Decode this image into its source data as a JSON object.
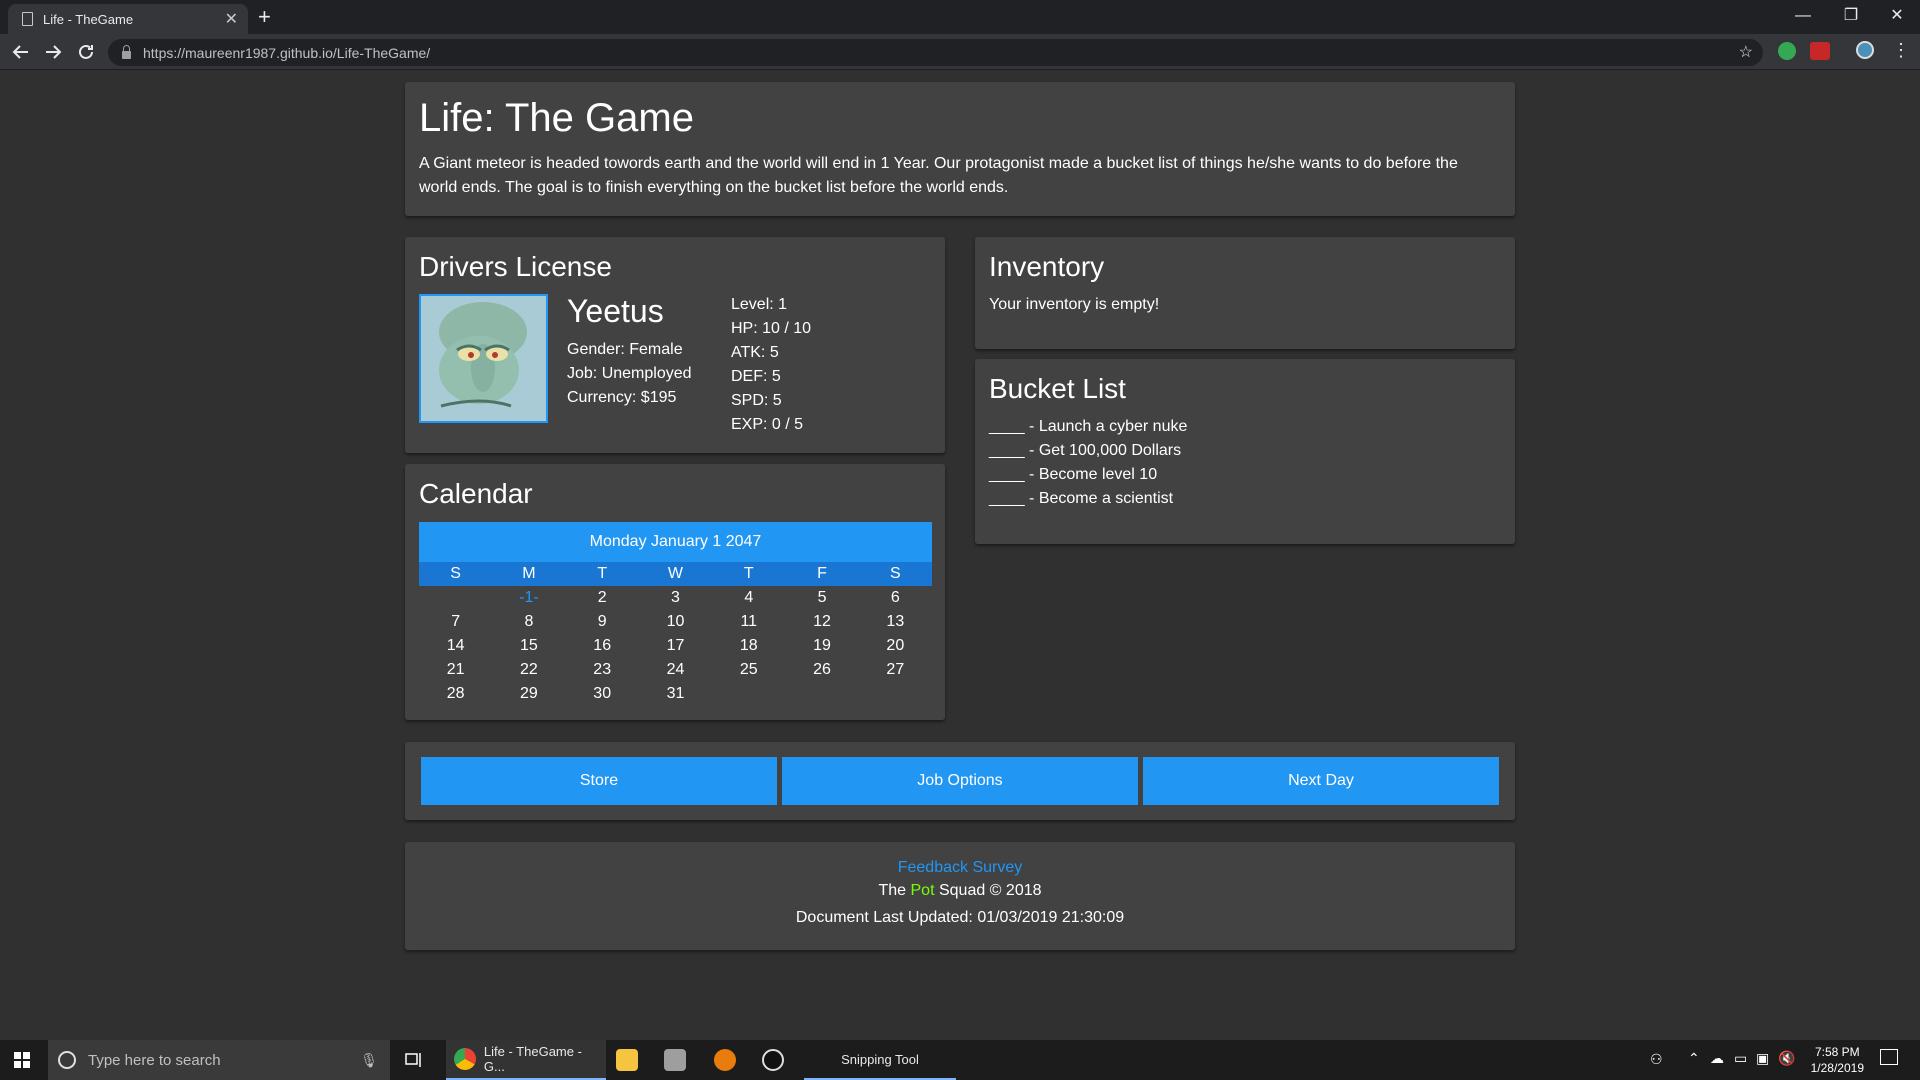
{
  "browser": {
    "tab_title": "Life - TheGame",
    "tab_close": "✕",
    "new_tab": "+",
    "url": "https://maureenr1987.github.io/Life-TheGame/",
    "minimize": "—",
    "restore": "❐",
    "close": "✕",
    "icons": [
      "back-arrow-icon",
      "forward-arrow-icon",
      "reload-icon",
      "lock-icon",
      "star-icon"
    ]
  },
  "header": {
    "title": "Life: The Game",
    "description": "A Giant meteor is headed towords earth and the world will end in 1 Year. Our protagonist made a bucket list of things he/she wants to do before the world ends. The goal is to finish everything on the bucket list before the world ends."
  },
  "license": {
    "heading": "Drivers License",
    "name": "Yeetus",
    "gender": "Gender: Female",
    "job": "Job: Unemployed",
    "currency": "Currency: $195",
    "stats": [
      "Level: 1",
      "HP: 10 / 10",
      "ATK: 5",
      "DEF: 5",
      "SPD: 5",
      "EXP: 0 / 5"
    ]
  },
  "inventory": {
    "heading": "Inventory",
    "empty_text": "Your inventory is empty!"
  },
  "bucket_list": {
    "heading": "Bucket List",
    "items": [
      "____ - Launch a cyber nuke",
      "____ - Get 100,000 Dollars",
      "____ - Become level 10",
      "____ - Become a scientist"
    ]
  },
  "calendar": {
    "heading": "Calendar",
    "date_label": "Monday January 1 2047",
    "weekdays": [
      "S",
      "M",
      "T",
      "W",
      "T",
      "F",
      "S"
    ],
    "weeks": [
      [
        "",
        "-1-",
        "2",
        "3",
        "4",
        "5",
        "6"
      ],
      [
        "7",
        "8",
        "9",
        "10",
        "11",
        "12",
        "13"
      ],
      [
        "14",
        "15",
        "16",
        "17",
        "18",
        "19",
        "20"
      ],
      [
        "21",
        "22",
        "23",
        "24",
        "25",
        "26",
        "27"
      ],
      [
        "28",
        "29",
        "30",
        "31",
        "",
        "",
        ""
      ]
    ]
  },
  "actions": {
    "store": "Store",
    "job_options": "Job Options",
    "next_day": "Next Day"
  },
  "footer": {
    "feedback": "Feedback Survey",
    "credit_prefix": "The",
    "credit_pot": "Pot",
    "credit_suffix": "Squad © 2018",
    "updated": "Document Last Updated: 01/03/2019 21:30:09"
  },
  "taskbar": {
    "search_placeholder": "Type here to search",
    "chrome_app": "Life - TheGame - G...",
    "snipping": "Snipping Tool",
    "time": "7:58 PM",
    "date": "1/28/2019"
  },
  "colors": {
    "accent": "#2196f3",
    "accent_dark": "#1976d2",
    "card": "#424242",
    "background": "#303030",
    "pot": "#76ff03"
  }
}
